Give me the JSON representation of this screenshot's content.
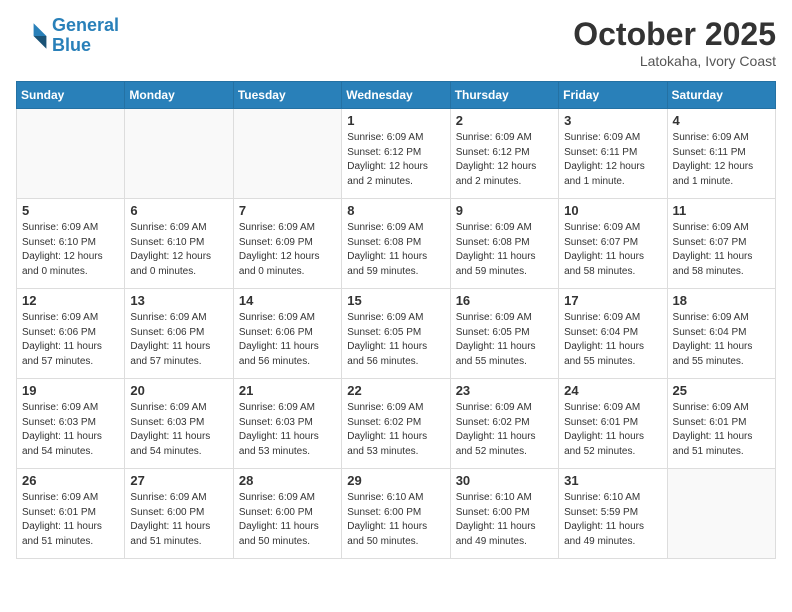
{
  "header": {
    "logo_line1": "General",
    "logo_line2": "Blue",
    "month": "October 2025",
    "location": "Latokaha, Ivory Coast"
  },
  "days_of_week": [
    "Sunday",
    "Monday",
    "Tuesday",
    "Wednesday",
    "Thursday",
    "Friday",
    "Saturday"
  ],
  "weeks": [
    [
      {
        "day": "",
        "info": ""
      },
      {
        "day": "",
        "info": ""
      },
      {
        "day": "",
        "info": ""
      },
      {
        "day": "1",
        "info": "Sunrise: 6:09 AM\nSunset: 6:12 PM\nDaylight: 12 hours\nand 2 minutes."
      },
      {
        "day": "2",
        "info": "Sunrise: 6:09 AM\nSunset: 6:12 PM\nDaylight: 12 hours\nand 2 minutes."
      },
      {
        "day": "3",
        "info": "Sunrise: 6:09 AM\nSunset: 6:11 PM\nDaylight: 12 hours\nand 1 minute."
      },
      {
        "day": "4",
        "info": "Sunrise: 6:09 AM\nSunset: 6:11 PM\nDaylight: 12 hours\nand 1 minute."
      }
    ],
    [
      {
        "day": "5",
        "info": "Sunrise: 6:09 AM\nSunset: 6:10 PM\nDaylight: 12 hours\nand 0 minutes."
      },
      {
        "day": "6",
        "info": "Sunrise: 6:09 AM\nSunset: 6:10 PM\nDaylight: 12 hours\nand 0 minutes."
      },
      {
        "day": "7",
        "info": "Sunrise: 6:09 AM\nSunset: 6:09 PM\nDaylight: 12 hours\nand 0 minutes."
      },
      {
        "day": "8",
        "info": "Sunrise: 6:09 AM\nSunset: 6:08 PM\nDaylight: 11 hours\nand 59 minutes."
      },
      {
        "day": "9",
        "info": "Sunrise: 6:09 AM\nSunset: 6:08 PM\nDaylight: 11 hours\nand 59 minutes."
      },
      {
        "day": "10",
        "info": "Sunrise: 6:09 AM\nSunset: 6:07 PM\nDaylight: 11 hours\nand 58 minutes."
      },
      {
        "day": "11",
        "info": "Sunrise: 6:09 AM\nSunset: 6:07 PM\nDaylight: 11 hours\nand 58 minutes."
      }
    ],
    [
      {
        "day": "12",
        "info": "Sunrise: 6:09 AM\nSunset: 6:06 PM\nDaylight: 11 hours\nand 57 minutes."
      },
      {
        "day": "13",
        "info": "Sunrise: 6:09 AM\nSunset: 6:06 PM\nDaylight: 11 hours\nand 57 minutes."
      },
      {
        "day": "14",
        "info": "Sunrise: 6:09 AM\nSunset: 6:06 PM\nDaylight: 11 hours\nand 56 minutes."
      },
      {
        "day": "15",
        "info": "Sunrise: 6:09 AM\nSunset: 6:05 PM\nDaylight: 11 hours\nand 56 minutes."
      },
      {
        "day": "16",
        "info": "Sunrise: 6:09 AM\nSunset: 6:05 PM\nDaylight: 11 hours\nand 55 minutes."
      },
      {
        "day": "17",
        "info": "Sunrise: 6:09 AM\nSunset: 6:04 PM\nDaylight: 11 hours\nand 55 minutes."
      },
      {
        "day": "18",
        "info": "Sunrise: 6:09 AM\nSunset: 6:04 PM\nDaylight: 11 hours\nand 55 minutes."
      }
    ],
    [
      {
        "day": "19",
        "info": "Sunrise: 6:09 AM\nSunset: 6:03 PM\nDaylight: 11 hours\nand 54 minutes."
      },
      {
        "day": "20",
        "info": "Sunrise: 6:09 AM\nSunset: 6:03 PM\nDaylight: 11 hours\nand 54 minutes."
      },
      {
        "day": "21",
        "info": "Sunrise: 6:09 AM\nSunset: 6:03 PM\nDaylight: 11 hours\nand 53 minutes."
      },
      {
        "day": "22",
        "info": "Sunrise: 6:09 AM\nSunset: 6:02 PM\nDaylight: 11 hours\nand 53 minutes."
      },
      {
        "day": "23",
        "info": "Sunrise: 6:09 AM\nSunset: 6:02 PM\nDaylight: 11 hours\nand 52 minutes."
      },
      {
        "day": "24",
        "info": "Sunrise: 6:09 AM\nSunset: 6:01 PM\nDaylight: 11 hours\nand 52 minutes."
      },
      {
        "day": "25",
        "info": "Sunrise: 6:09 AM\nSunset: 6:01 PM\nDaylight: 11 hours\nand 51 minutes."
      }
    ],
    [
      {
        "day": "26",
        "info": "Sunrise: 6:09 AM\nSunset: 6:01 PM\nDaylight: 11 hours\nand 51 minutes."
      },
      {
        "day": "27",
        "info": "Sunrise: 6:09 AM\nSunset: 6:00 PM\nDaylight: 11 hours\nand 51 minutes."
      },
      {
        "day": "28",
        "info": "Sunrise: 6:09 AM\nSunset: 6:00 PM\nDaylight: 11 hours\nand 50 minutes."
      },
      {
        "day": "29",
        "info": "Sunrise: 6:10 AM\nSunset: 6:00 PM\nDaylight: 11 hours\nand 50 minutes."
      },
      {
        "day": "30",
        "info": "Sunrise: 6:10 AM\nSunset: 6:00 PM\nDaylight: 11 hours\nand 49 minutes."
      },
      {
        "day": "31",
        "info": "Sunrise: 6:10 AM\nSunset: 5:59 PM\nDaylight: 11 hours\nand 49 minutes."
      },
      {
        "day": "",
        "info": ""
      }
    ]
  ]
}
